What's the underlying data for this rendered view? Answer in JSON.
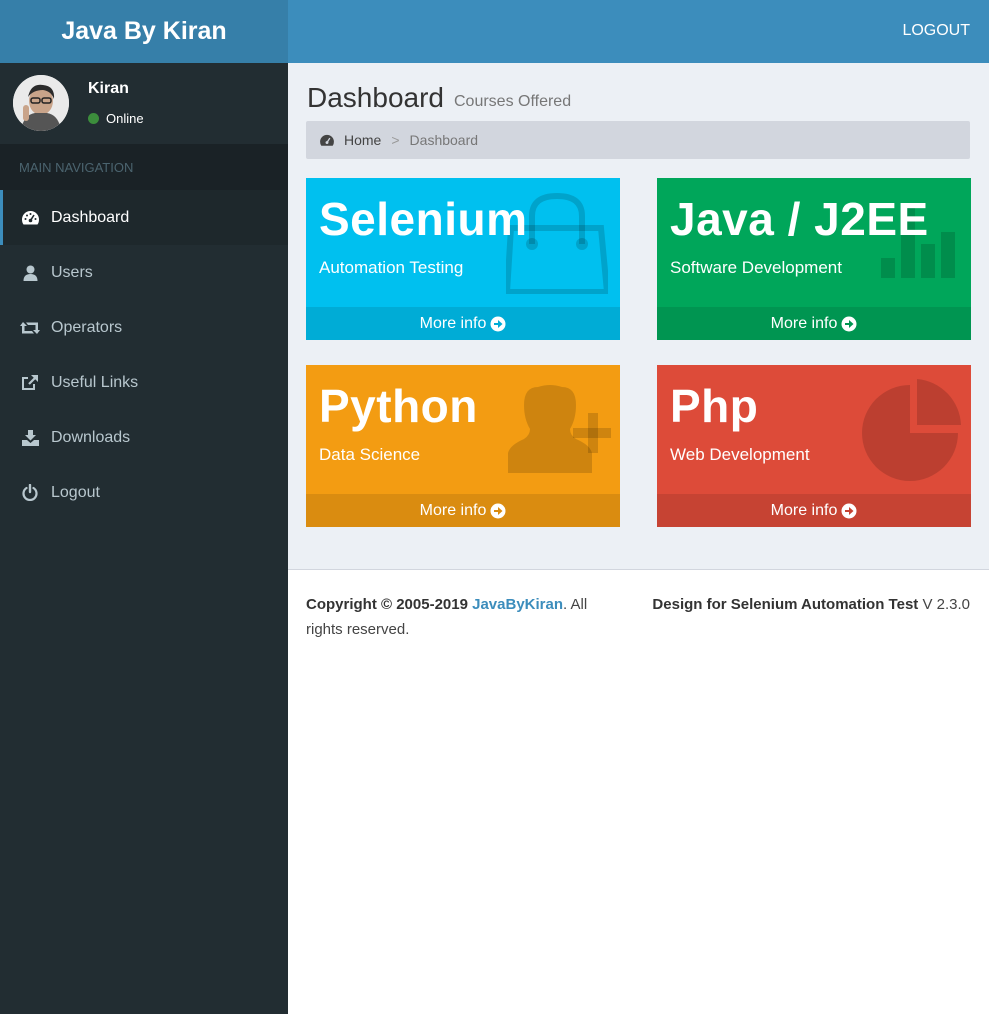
{
  "brand": {
    "title": "Java By Kiran"
  },
  "user": {
    "name": "Kiran",
    "status": "Online"
  },
  "nav": {
    "header": "MAIN NAVIGATION",
    "items": [
      {
        "label": "Dashboard",
        "icon": "dashboard-icon"
      },
      {
        "label": "Users",
        "icon": "user-icon"
      },
      {
        "label": "Operators",
        "icon": "retweet-icon"
      },
      {
        "label": "Useful Links",
        "icon": "external-link-icon"
      },
      {
        "label": "Downloads",
        "icon": "download-icon"
      },
      {
        "label": "Logout",
        "icon": "power-icon"
      }
    ]
  },
  "topbar": {
    "logout": "LOGOUT"
  },
  "page": {
    "title": "Dashboard",
    "subtitle": "Courses Offered"
  },
  "breadcrumb": {
    "home": "Home",
    "separator": ">",
    "current": "Dashboard"
  },
  "cards": [
    {
      "title": "Selenium",
      "subtitle": "Automation Testing",
      "more": "More info",
      "color": "#00c0ef",
      "footer_color": "#00acd6",
      "icon": "shopping-bag-icon"
    },
    {
      "title": "Java / J2EE",
      "subtitle": "Software Development",
      "more": "More info",
      "color": "#00a65a",
      "footer_color": "#009551",
      "icon": "bar-chart-icon"
    },
    {
      "title": "Python",
      "subtitle": "Data Science",
      "more": "More info",
      "color": "#f39c12",
      "footer_color": "#da8c10",
      "icon": "user-add-icon"
    },
    {
      "title": "Php",
      "subtitle": "Web Development",
      "more": "More info",
      "color": "#dd4b39",
      "footer_color": "#c64333",
      "icon": "pie-chart-icon"
    }
  ],
  "footer": {
    "copyright_prefix": "Copyright © 2005-2019",
    "brand_link": "JavaByKiran",
    "copyright_suffix": ". All rights reserved.",
    "design_label": "Design for Selenium Automation Test",
    "version": "V 2.3.0"
  }
}
